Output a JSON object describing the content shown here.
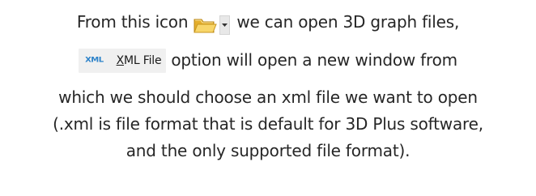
{
  "paragraph": {
    "line1_before": "From this icon",
    "line1_after": "we can open 3D graph files,",
    "menu_item": {
      "icon_text": "XML",
      "mnemonic": "X",
      "label_rest": "ML File"
    },
    "line2_after": "option will open a new window from",
    "line3": "which we should choose an xml file we want to open",
    "line4": "(.xml is file format that is default for 3D Plus software,",
    "line5": "and the only supported file format)."
  },
  "icons": {
    "open_button": "folder-open-icon",
    "dropdown": "chevron-down-icon",
    "xml_file": "xml-file-icon"
  },
  "colors": {
    "text": "#262626",
    "folder_yellow": "#f2c94c",
    "xml_blue": "#2c82c9",
    "menu_bg": "#f0f0f0"
  }
}
